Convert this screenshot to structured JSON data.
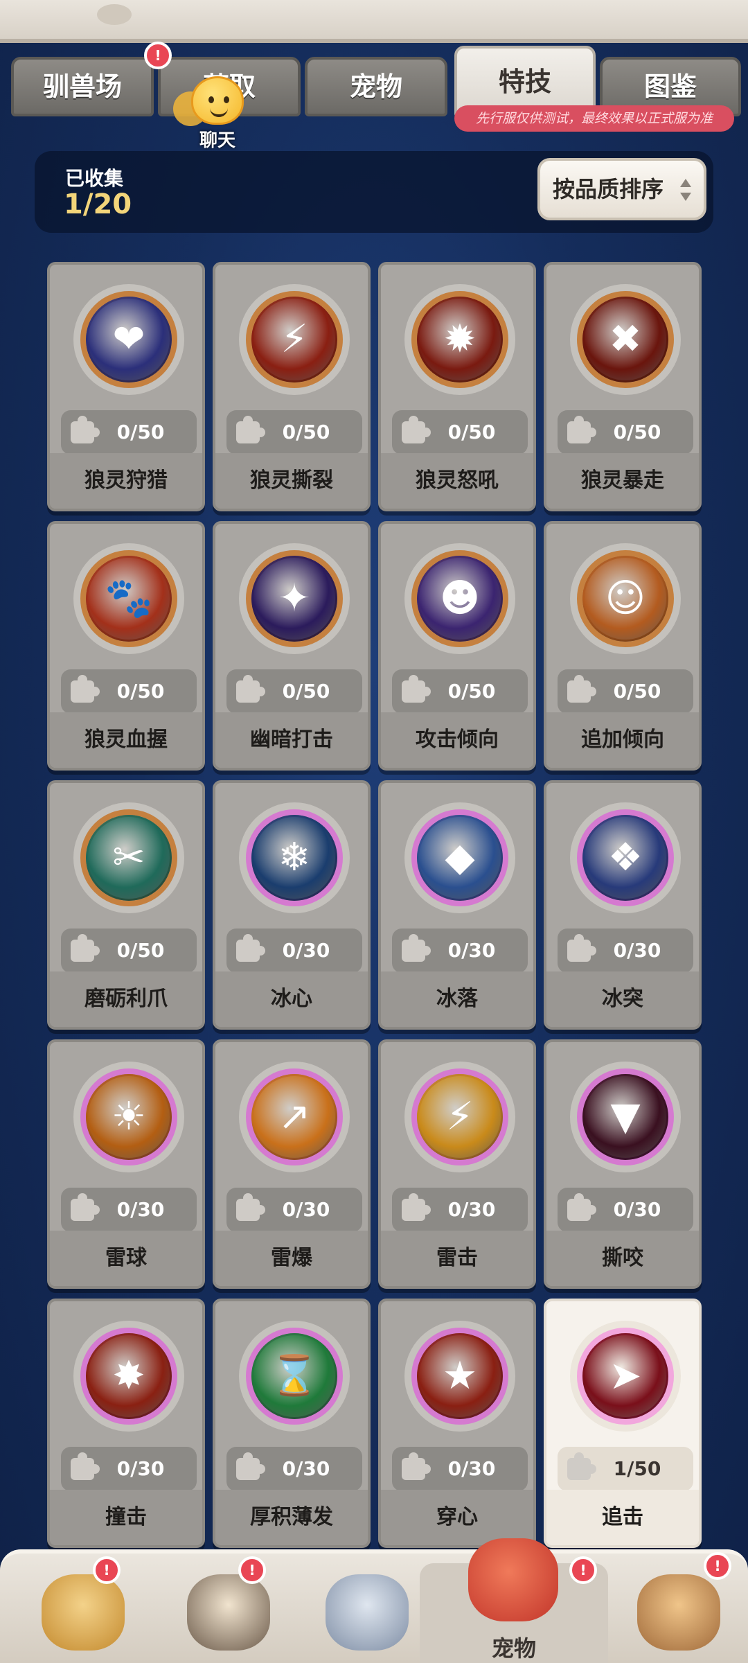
{
  "tabs": [
    {
      "label": "驯兽场"
    },
    {
      "label": "获取"
    },
    {
      "label": "宠物"
    },
    {
      "label": "特技"
    },
    {
      "label": "图鉴"
    }
  ],
  "tab_notice": "先行服仅供测试，最终效果以正式服为准",
  "chat": {
    "label": "聊天"
  },
  "collection": {
    "label": "已收集",
    "value": "1/20"
  },
  "sort_button": {
    "label": "按品质排序"
  },
  "skills": [
    {
      "name": "狼灵狩猎",
      "count": "0/50",
      "icon": "crosshair-heart-icon",
      "ring": "orange",
      "color": "#2b2f7a",
      "glyph": "❤"
    },
    {
      "name": "狼灵撕裂",
      "count": "0/50",
      "icon": "claw-slash-icon",
      "ring": "orange",
      "color": "#8a1f12",
      "glyph": "⚡"
    },
    {
      "name": "狼灵怒吼",
      "count": "0/50",
      "icon": "explosion-icon",
      "ring": "orange",
      "color": "#7a1a10",
      "glyph": "✹"
    },
    {
      "name": "狼灵暴走",
      "count": "0/50",
      "icon": "cross-slash-icon",
      "ring": "orange",
      "color": "#6a150d",
      "glyph": "✖"
    },
    {
      "name": "狼灵血握",
      "count": "0/50",
      "icon": "paw-icon",
      "ring": "orange",
      "color": "#a3301a",
      "glyph": "🐾"
    },
    {
      "name": "幽暗打击",
      "count": "0/50",
      "icon": "dark-burst-icon",
      "ring": "orange",
      "color": "#2b1b5c",
      "glyph": "✦"
    },
    {
      "name": "攻击倾向",
      "count": "0/50",
      "icon": "owl-face-icon",
      "ring": "orange",
      "color": "#3b2470",
      "glyph": "☻"
    },
    {
      "name": "追加倾向",
      "count": "0/50",
      "icon": "sleepy-face-icon",
      "ring": "orange",
      "color": "#b35b1f",
      "glyph": "☺"
    },
    {
      "name": "磨砺利爪",
      "count": "0/50",
      "icon": "sharpen-claw-icon",
      "ring": "orange",
      "color": "#1f6a5a",
      "glyph": "✂"
    },
    {
      "name": "冰心",
      "count": "0/30",
      "icon": "snowflake-icon",
      "ring": "purple",
      "color": "#1a3d6e",
      "glyph": "❄"
    },
    {
      "name": "冰落",
      "count": "0/30",
      "icon": "ice-shard-icon",
      "ring": "purple",
      "color": "#2a4f8f",
      "glyph": "◆"
    },
    {
      "name": "冰突",
      "count": "0/30",
      "icon": "ice-crystal-icon",
      "ring": "purple",
      "color": "#273a7a",
      "glyph": "❖"
    },
    {
      "name": "雷球",
      "count": "0/30",
      "icon": "thunder-orb-icon",
      "ring": "purple",
      "color": "#b35e12",
      "glyph": "☀"
    },
    {
      "name": "雷爆",
      "count": "0/30",
      "icon": "thunder-burst-icon",
      "ring": "purple",
      "color": "#c9701a",
      "glyph": "↗"
    },
    {
      "name": "雷击",
      "count": "0/30",
      "icon": "thunder-strike-icon",
      "ring": "purple",
      "color": "#c98a1a",
      "glyph": "⚡"
    },
    {
      "name": "撕咬",
      "count": "0/30",
      "icon": "bite-mouth-icon",
      "ring": "purple",
      "color": "#3a1020",
      "glyph": "▼"
    },
    {
      "name": "撞击",
      "count": "0/30",
      "icon": "impact-icon",
      "ring": "purple",
      "color": "#8a2012",
      "glyph": "✸"
    },
    {
      "name": "厚积薄发",
      "count": "0/30",
      "icon": "hourglass-icon",
      "ring": "purple",
      "color": "#1f7a3a",
      "glyph": "⌛"
    },
    {
      "name": "穿心",
      "count": "0/30",
      "icon": "star-fist-icon",
      "ring": "purple",
      "color": "#8a1f12",
      "glyph": "★"
    },
    {
      "name": "追击",
      "count": "1/50",
      "icon": "chase-strike-icon",
      "ring": "pink",
      "color": "#7a0f1a",
      "glyph": "➤",
      "selected": true
    }
  ],
  "bottom_nav": [
    {
      "icon": "beast-avatar-icon",
      "label": "",
      "color": "#d6a548"
    },
    {
      "icon": "hero-avatar-icon",
      "label": "",
      "color": "#6b5a4a"
    },
    {
      "icon": "sword-shield-icon",
      "label": "",
      "color": "#8a9ab0"
    },
    {
      "icon": "pet-dino-icon",
      "label": "宠物",
      "color": "#d64a3a"
    },
    {
      "icon": "totem-avatar-icon",
      "label": "",
      "color": "#c9a06a"
    }
  ]
}
